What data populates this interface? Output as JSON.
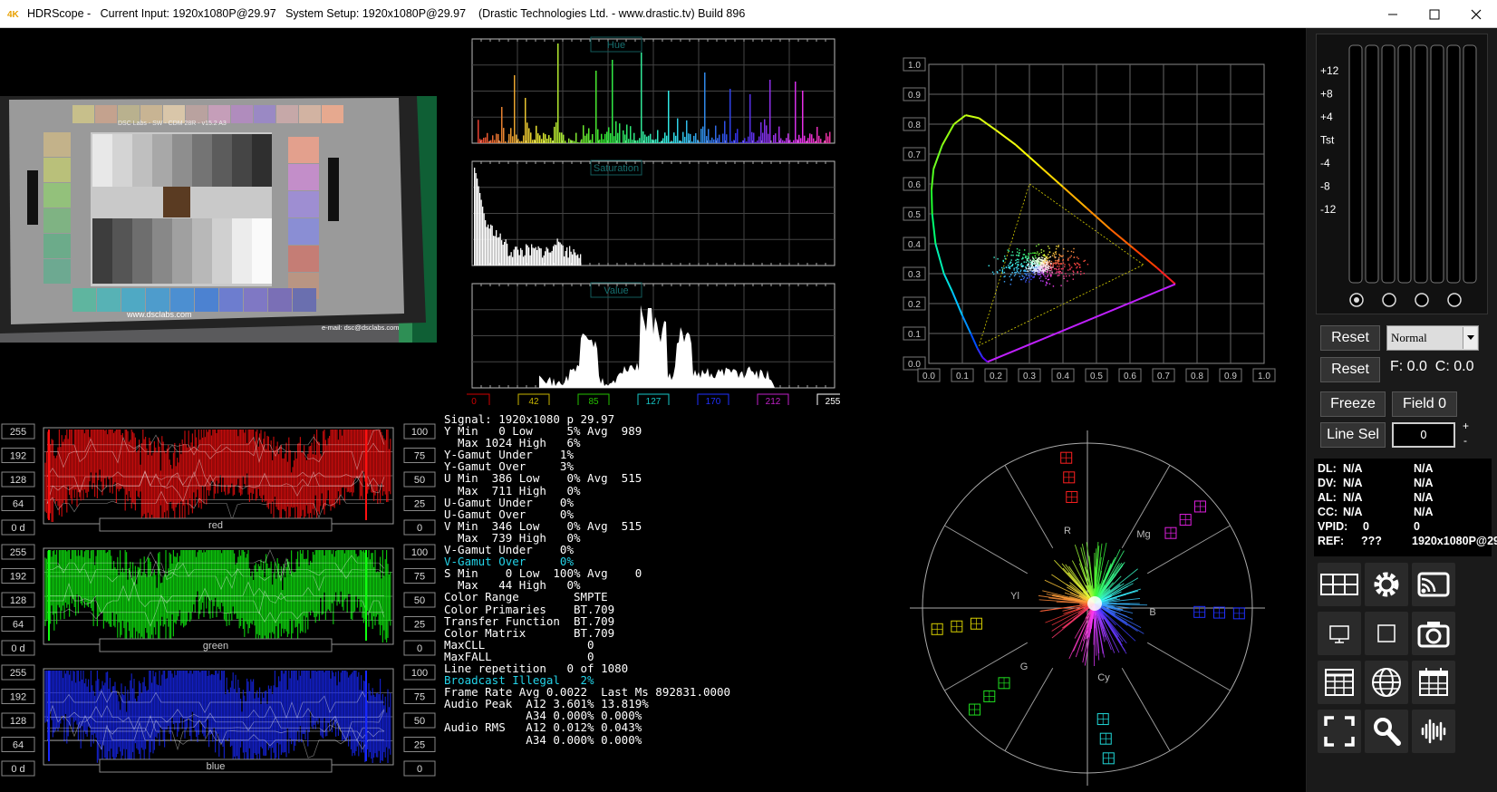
{
  "titlebar": {
    "app_name": "HDRScope",
    "current_input": "Current Input: 1920x1080P@29.97",
    "system_setup": "System Setup: 1920x1080P@29.97",
    "vendor": "(Drastic Technologies Ltd. - www.drastic.tv) Build 896",
    "minimize": "—",
    "maximize": "☐",
    "close": "✕"
  },
  "histograms": {
    "hue_label": "Hue",
    "saturation_label": "Saturation",
    "value_label": "Value",
    "scale_markers": [
      "0",
      "42",
      "85",
      "127",
      "170",
      "212",
      "255"
    ],
    "scale_colors": [
      "#d00000",
      "#c8b400",
      "#25c000",
      "#16c8c8",
      "#2030ff",
      "#c020c8",
      "#ffffff"
    ]
  },
  "parade": {
    "left_ticks": [
      "255",
      "192",
      "128",
      "64",
      "0 d"
    ],
    "right_ticks": [
      "100",
      "75",
      "50",
      "25",
      "0"
    ],
    "channels": [
      {
        "label": "red",
        "color": "#ff1010"
      },
      {
        "label": "green",
        "color": "#10ff10"
      },
      {
        "label": "blue",
        "color": "#1828ff"
      }
    ]
  },
  "stats": {
    "lines": [
      "Signal: 1920x1080 p 29.97",
      "Y Min   0 Low     5% Avg  989",
      "  Max 1024 High   6%",
      "Y-Gamut Under    1%",
      "Y-Gamut Over     3%",
      "U Min  386 Low    0% Avg  515",
      "  Max  711 High   0%",
      "U-Gamut Under    0%",
      "U-Gamut Over     0%",
      "V Min  346 Low    0% Avg  515",
      "  Max  739 High   0%",
      "V-Gamut Under    0%",
      "V-Gamut Over     0%",
      "S Min    0 Low  100% Avg    0",
      "  Max   44 High   0%",
      "Color Range        SMPTE",
      "Color Primaries    BT.709",
      "Transfer Function  BT.709",
      "Color Matrix       BT.709",
      "MaxCLL               0",
      "MaxFALL              0",
      "Line repetition   0 of 1080",
      "Broadcast Illegal   2%",
      "Frame Rate Avg 0.0022  Last Ms 892831.0000",
      "Audio Peak  A12 3.601% 13.819%",
      "            A34 0.000% 0.000%",
      "Audio RMS   A12 0.012% 0.043%",
      "            A34 0.000% 0.000%"
    ],
    "highlight_lines": [
      12,
      22
    ]
  },
  "cie": {
    "y_ticks": [
      "1.0",
      "0.9",
      "0.8",
      "0.7",
      "0.6",
      "0.5",
      "0.4",
      "0.3",
      "0.2",
      "0.1",
      "0.0"
    ],
    "x_ticks": [
      "0.0",
      "0.1",
      "0.2",
      "0.3",
      "0.4",
      "0.5",
      "0.6",
      "0.7",
      "0.8",
      "0.9",
      "1.0"
    ]
  },
  "vectorscope": {
    "labels": [
      "R",
      "Mg",
      "Yl",
      "B",
      "G",
      "Cy"
    ]
  },
  "meters": {
    "scale": [
      "+12",
      "+8",
      "+4",
      "Tst",
      "-4",
      "-8",
      "-12"
    ]
  },
  "controls": {
    "reset1": "Reset",
    "mode_select": "Normal",
    "reset2": "Reset",
    "fc_readout": "F: 0.0  C: 0.0",
    "freeze": "Freeze",
    "field": "Field 0",
    "line_sel": "Line Sel",
    "line_value": "0",
    "plus": "+",
    "minus": "-"
  },
  "info": [
    {
      "key": "DL:",
      "a": "N/A",
      "b": "N/A"
    },
    {
      "key": "DV:",
      "a": "N/A",
      "b": "N/A"
    },
    {
      "key": "AL:",
      "a": "N/A",
      "b": "N/A"
    },
    {
      "key": "CC:",
      "a": "N/A",
      "b": "N/A"
    },
    {
      "key": "VPID:",
      "a": "0",
      "b": "0"
    },
    {
      "key": "REF:",
      "a": "???",
      "b": "1920x1080P@29"
    }
  ],
  "chart_preview": {
    "title": "DSC Labs - SW - CDM 28R - v15.2 A3",
    "url": "www.dsclabs.com",
    "email": "e-mail: dsc@dsclabs.com"
  },
  "icons": [
    "layout-icon",
    "gear-icon",
    "cast-icon",
    "monitor-icon",
    "square-icon",
    "camera-icon",
    "table-icon",
    "globe-icon",
    "calendar-icon",
    "fullscreen-icon",
    "search-icon",
    "waveform-icon"
  ]
}
